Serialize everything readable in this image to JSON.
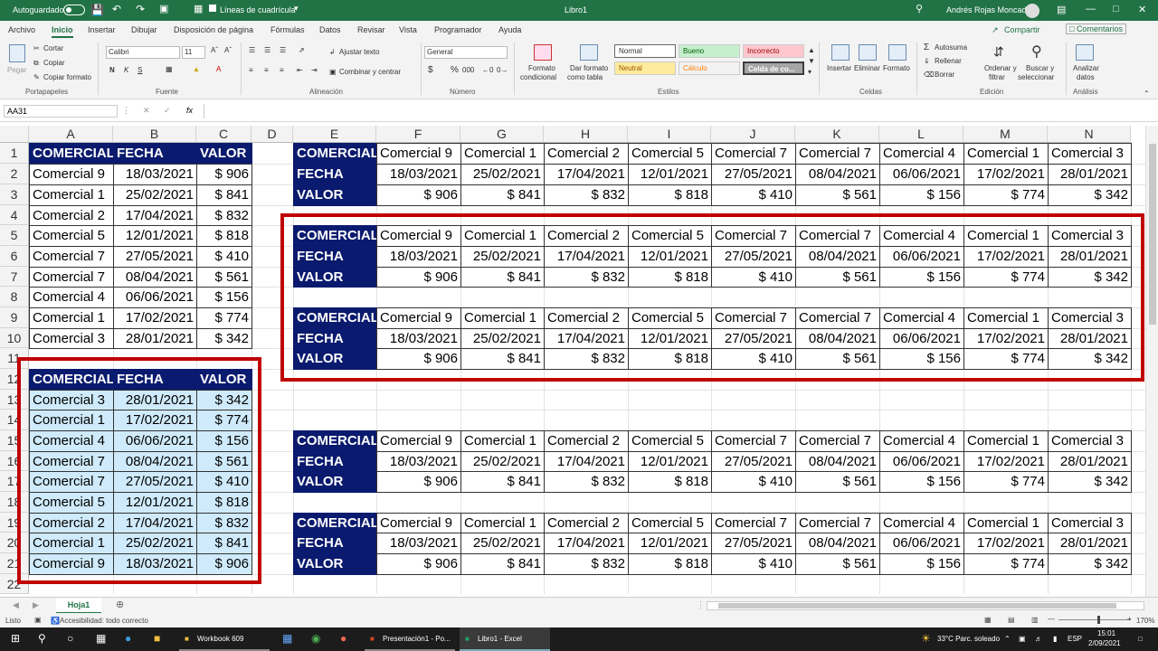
{
  "titlebar": {
    "autosave": "Autoguardado",
    "gridlines": "Líneas de cuadrícula",
    "title": "Libro1",
    "user": "Andrés Rojas Moncada"
  },
  "menu": {
    "tabs": [
      "Archivo",
      "Inicio",
      "Insertar",
      "Dibujar",
      "Disposición de página",
      "Fórmulas",
      "Datos",
      "Revisar",
      "Vista",
      "Programador",
      "Ayuda"
    ],
    "share": "Compartir",
    "comments": "Comentarios"
  },
  "ribbon": {
    "paste": "Pegar",
    "cut": "Cortar",
    "copy": "Copiar",
    "copy_format": "Copiar formato",
    "clipboard": "Portapapeles",
    "font_name": "Calibri",
    "font_size": "11",
    "font_group": "Fuente",
    "bold": "N",
    "italic": "K",
    "underline": "S",
    "wrap": "Ajustar texto",
    "merge": "Combinar y centrar",
    "alignment": "Alineación",
    "number_format": "General",
    "number_group": "Número",
    "currency": "$",
    "percent": "%",
    "thousands": "000",
    "cond_format_1": "Formato",
    "cond_format_2": "condicional",
    "as_table_1": "Dar formato",
    "as_table_2": "como tabla",
    "style_normal": "Normal",
    "style_bueno": "Bueno",
    "style_incorrecto": "Incorrecto",
    "style_neutral": "Neutral",
    "style_calculo": "Cálculo",
    "style_celda": "Celda de co...",
    "styles_group": "Estilos",
    "insert": "Insertar",
    "delete": "Eliminar",
    "format": "Formato",
    "cells_group": "Celdas",
    "autosum": "Autosuma",
    "fill": "Rellenar",
    "clear": "Borrar",
    "sort_1": "Ordenar y",
    "sort_2": "filtrar",
    "find_1": "Buscar y",
    "find_2": "seleccionar",
    "editing_group": "Edición",
    "analyze_1": "Analizar",
    "analyze_2": "datos",
    "analysis_group": "Análisis"
  },
  "formula": {
    "namebox": "AA31",
    "fx": "fx",
    "value": ""
  },
  "columns": [
    "A",
    "B",
    "C",
    "D",
    "E",
    "F",
    "G",
    "H",
    "I",
    "J",
    "K",
    "L",
    "M",
    "N"
  ],
  "rows": [
    "1",
    "2",
    "3",
    "4",
    "5",
    "6",
    "7",
    "8",
    "9",
    "10",
    "11",
    "12",
    "13",
    "14",
    "15",
    "16",
    "17",
    "18",
    "19",
    "20",
    "21",
    "22"
  ],
  "table1": {
    "headers": [
      "COMERCIAL",
      "FECHA",
      "VALOR"
    ],
    "rows": [
      [
        "Comercial 9",
        "18/03/2021",
        "$ 906"
      ],
      [
        "Comercial 1",
        "25/02/2021",
        "$ 841"
      ],
      [
        "Comercial 2",
        "17/04/2021",
        "$ 832"
      ],
      [
        "Comercial 5",
        "12/01/2021",
        "$ 818"
      ],
      [
        "Comercial 7",
        "27/05/2021",
        "$ 410"
      ],
      [
        "Comercial 7",
        "08/04/2021",
        "$ 561"
      ],
      [
        "Comercial 4",
        "06/06/2021",
        "$ 156"
      ],
      [
        "Comercial 1",
        "17/02/2021",
        "$ 774"
      ],
      [
        "Comercial 3",
        "28/01/2021",
        "$ 342"
      ]
    ]
  },
  "table2": {
    "headers": [
      "COMERCIAL",
      "FECHA",
      "VALOR"
    ],
    "rows": [
      [
        "Comercial 3",
        "28/01/2021",
        "$ 342"
      ],
      [
        "Comercial 1",
        "17/02/2021",
        "$ 774"
      ],
      [
        "Comercial 4",
        "06/06/2021",
        "$ 156"
      ],
      [
        "Comercial 7",
        "08/04/2021",
        "$ 561"
      ],
      [
        "Comercial 7",
        "27/05/2021",
        "$ 410"
      ],
      [
        "Comercial 5",
        "12/01/2021",
        "$ 818"
      ],
      [
        "Comercial 2",
        "17/04/2021",
        "$ 832"
      ],
      [
        "Comercial 1",
        "25/02/2021",
        "$ 841"
      ],
      [
        "Comercial 9",
        "18/03/2021",
        "$ 906"
      ]
    ]
  },
  "htables": [
    {
      "row_labels": [
        "COMERCIAL",
        "FECHA",
        "VALOR"
      ],
      "comercial": [
        "Comercial 9",
        "Comercial 1",
        "Comercial 2",
        "Comercial 5",
        "Comercial 7",
        "Comercial 7",
        "Comercial 4",
        "Comercial 1",
        "Comercial 3"
      ],
      "fecha": [
        "18/03/2021",
        "25/02/2021",
        "17/04/2021",
        "12/01/2021",
        "27/05/2021",
        "08/04/2021",
        "06/06/2021",
        "17/02/2021",
        "28/01/2021"
      ],
      "valor": [
        "$ 906",
        "$ 841",
        "$ 832",
        "$ 818",
        "$ 410",
        "$ 561",
        "$ 156",
        "$ 774",
        "$ 342"
      ]
    },
    {
      "row_labels": [
        "COMERCIAL",
        "FECHA",
        "VALOR"
      ],
      "comercial": [
        "Comercial 9",
        "Comercial 1",
        "Comercial 2",
        "Comercial 5",
        "Comercial 7",
        "Comercial 7",
        "Comercial 4",
        "Comercial 1",
        "Comercial 3"
      ],
      "fecha": [
        "18/03/2021",
        "25/02/2021",
        "17/04/2021",
        "12/01/2021",
        "27/05/2021",
        "08/04/2021",
        "06/06/2021",
        "17/02/2021",
        "28/01/2021"
      ],
      "valor": [
        "$ 906",
        "$ 841",
        "$ 832",
        "$ 818",
        "$ 410",
        "$ 561",
        "$ 156",
        "$ 774",
        "$ 342"
      ]
    },
    {
      "row_labels": [
        "COMERCIAL",
        "FECHA",
        "VALOR"
      ],
      "comercial": [
        "Comercial 9",
        "Comercial 1",
        "Comercial 2",
        "Comercial 5",
        "Comercial 7",
        "Comercial 7",
        "Comercial 4",
        "Comercial 1",
        "Comercial 3"
      ],
      "fecha": [
        "18/03/2021",
        "25/02/2021",
        "17/04/2021",
        "12/01/2021",
        "27/05/2021",
        "08/04/2021",
        "06/06/2021",
        "17/02/2021",
        "28/01/2021"
      ],
      "valor": [
        "$ 906",
        "$ 841",
        "$ 832",
        "$ 818",
        "$ 410",
        "$ 561",
        "$ 156",
        "$ 774",
        "$ 342"
      ]
    },
    {
      "row_labels": [
        "COMERCIAL",
        "FECHA",
        "VALOR"
      ],
      "comercial": [
        "Comercial 9",
        "Comercial 1",
        "Comercial 2",
        "Comercial 5",
        "Comercial 7",
        "Comercial 7",
        "Comercial 4",
        "Comercial 1",
        "Comercial 3"
      ],
      "fecha": [
        "18/03/2021",
        "25/02/2021",
        "17/04/2021",
        "12/01/2021",
        "27/05/2021",
        "08/04/2021",
        "06/06/2021",
        "17/02/2021",
        "28/01/2021"
      ],
      "valor": [
        "$ 906",
        "$ 841",
        "$ 832",
        "$ 818",
        "$ 410",
        "$ 561",
        "$ 156",
        "$ 774",
        "$ 342"
      ]
    },
    {
      "row_labels": [
        "COMERCIAL",
        "FECHA",
        "VALOR"
      ],
      "comercial": [
        "Comercial 9",
        "Comercial 1",
        "Comercial 2",
        "Comercial 5",
        "Comercial 7",
        "Comercial 7",
        "Comercial 4",
        "Comercial 1",
        "Comercial 3"
      ],
      "fecha": [
        "18/03/2021",
        "25/02/2021",
        "17/04/2021",
        "12/01/2021",
        "27/05/2021",
        "08/04/2021",
        "06/06/2021",
        "17/02/2021",
        "28/01/2021"
      ],
      "valor": [
        "$ 906",
        "$ 841",
        "$ 832",
        "$ 818",
        "$ 410",
        "$ 561",
        "$ 156",
        "$ 774",
        "$ 342"
      ]
    }
  ],
  "sheet_tab": "Hoja1",
  "status": {
    "ready": "Listo",
    "accessibility": "Accesibilidad: todo correcto",
    "zoom": "170%"
  },
  "taskbar": {
    "apps": [
      "Workbook 609",
      "Presentación1 - Po...",
      "Libro1 - Excel"
    ],
    "weather": "33°C  Parc. soleado",
    "lang": "ESP",
    "time": "15:01",
    "date": "2/09/2021"
  },
  "colors": {
    "header_bg": "#0a1a6e",
    "highlight_bg": "#cfeafa",
    "frame": "#c00000",
    "excel_green": "#217346"
  }
}
